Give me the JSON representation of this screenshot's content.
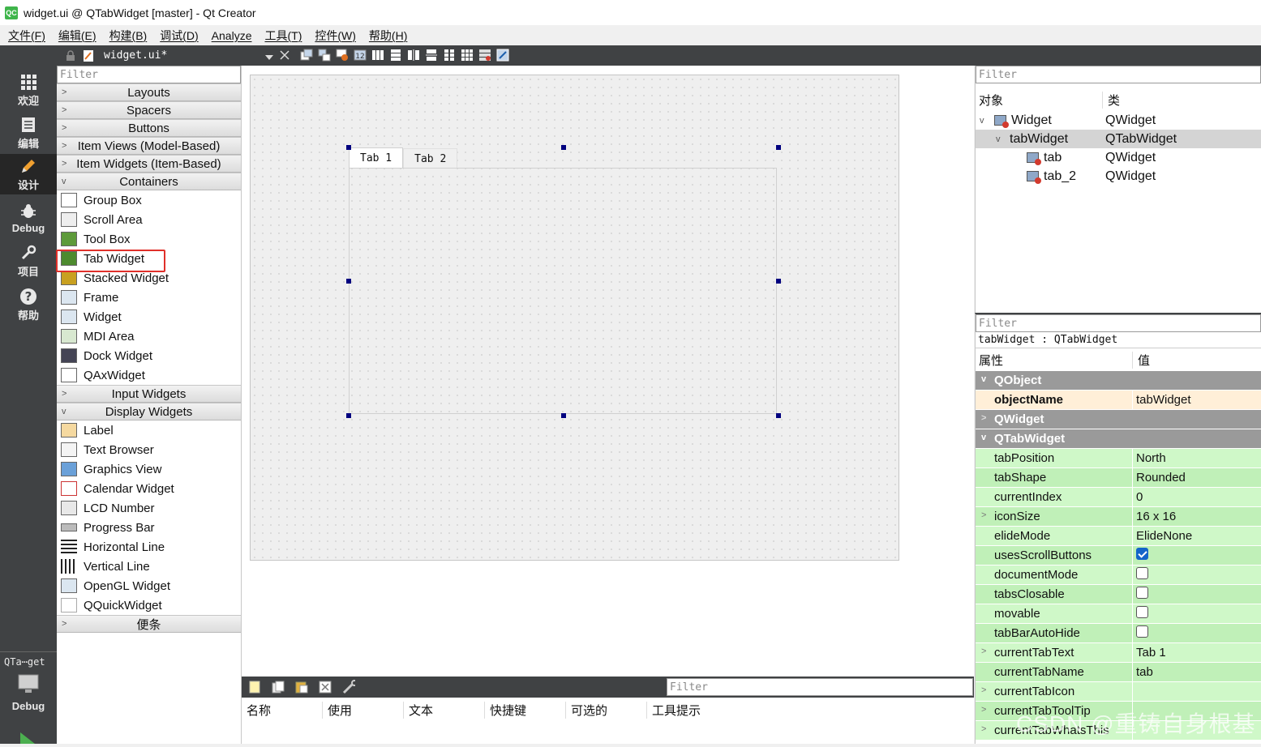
{
  "window": {
    "title": "widget.ui @ QTabWidget [master] - Qt Creator",
    "logo": "QC"
  },
  "menu": [
    "文件(F)",
    "编辑(E)",
    "构建(B)",
    "调试(D)",
    "Analyze",
    "工具(T)",
    "控件(W)",
    "帮助(H)"
  ],
  "modes": [
    {
      "label": "欢迎",
      "icon": "grid-icon"
    },
    {
      "label": "编辑",
      "icon": "document-icon"
    },
    {
      "label": "设计",
      "icon": "pencil-icon"
    },
    {
      "label": "Debug",
      "icon": "bug-icon"
    },
    {
      "label": "项目",
      "icon": "wrench-icon"
    },
    {
      "label": "帮助",
      "icon": "help-icon"
    }
  ],
  "kit": {
    "name": "QTa⋯get",
    "mode": "Debug"
  },
  "doc": {
    "filename": "widget.ui*"
  },
  "widgetbox": {
    "filter_placeholder": "Filter",
    "categories_top": [
      "Layouts",
      "Spacers",
      "Buttons",
      "Item Views (Model-Based)",
      "Item Widgets (Item-Based)"
    ],
    "containers_label": "Containers",
    "containers": [
      "Group Box",
      "Scroll Area",
      "Tool Box",
      "Tab Widget",
      "Stacked Widget",
      "Frame",
      "Widget",
      "MDI Area",
      "Dock Widget",
      "QAxWidget"
    ],
    "input_label": "Input Widgets",
    "display_label": "Display Widgets",
    "display": [
      "Label",
      "Text Browser",
      "Graphics View",
      "Calendar Widget",
      "LCD Number",
      "Progress Bar",
      "Horizontal Line",
      "Vertical Line",
      "OpenGL Widget",
      "QQuickWidget"
    ],
    "last_label": "便条"
  },
  "form": {
    "tabs": [
      "Tab 1",
      "Tab 2"
    ]
  },
  "action_editor": {
    "filter_placeholder": "Filter",
    "columns": [
      "名称",
      "使用",
      "文本",
      "快捷键",
      "可选的",
      "工具提示"
    ]
  },
  "object_inspector": {
    "filter_placeholder": "Filter",
    "col_object": "对象",
    "col_class": "类",
    "rows": [
      {
        "name": "Widget",
        "class": "QWidget"
      },
      {
        "name": "tabWidget",
        "class": "QTabWidget"
      },
      {
        "name": "tab",
        "class": "QWidget"
      },
      {
        "name": "tab_2",
        "class": "QWidget"
      }
    ]
  },
  "property_editor": {
    "filter_placeholder": "Filter",
    "selection": "tabWidget : QTabWidget",
    "col_prop": "属性",
    "col_value": "值",
    "groups": {
      "qobject": "QObject",
      "qwidget": "QWidget",
      "qtabwidget": "QTabWidget"
    },
    "objectName": {
      "name": "objectName",
      "value": "tabWidget"
    },
    "props": [
      {
        "name": "tabPosition",
        "value": "North"
      },
      {
        "name": "tabShape",
        "value": "Rounded"
      },
      {
        "name": "currentIndex",
        "value": "0"
      },
      {
        "name": "iconSize",
        "value": "16 x 16"
      },
      {
        "name": "elideMode",
        "value": "ElideNone"
      },
      {
        "name": "usesScrollButtons",
        "checked": true
      },
      {
        "name": "documentMode",
        "checked": false
      },
      {
        "name": "tabsClosable",
        "checked": false
      },
      {
        "name": "movable",
        "checked": false
      },
      {
        "name": "tabBarAutoHide",
        "checked": false
      },
      {
        "name": "currentTabText",
        "value": "Tab 1"
      },
      {
        "name": "currentTabName",
        "value": "tab"
      },
      {
        "name": "currentTabIcon",
        "value": ""
      },
      {
        "name": "currentTabToolTip",
        "value": ""
      },
      {
        "name": "currentTabWhatsThis",
        "value": ""
      }
    ]
  },
  "watermark": "CSDN @重铸自身根基",
  "colors": {
    "modebar": "#404244",
    "highlight": "#e0302a",
    "group": "#9a9a9a",
    "prop_green": "#cff8c8"
  }
}
